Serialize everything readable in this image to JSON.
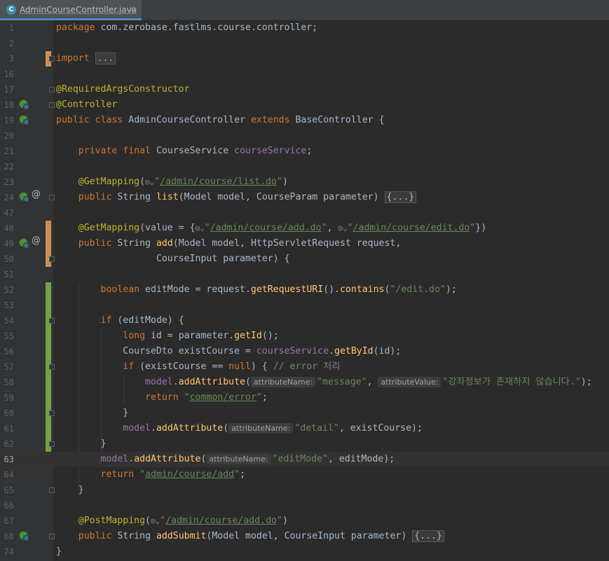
{
  "tab": {
    "icon": "C",
    "title": "AdminCourseController.java",
    "close": "×"
  },
  "colors": {
    "background": "#2b2b2b",
    "gutter": "#313335",
    "keyword": "#cc7832",
    "annotation": "#bbb529",
    "string": "#6a8759",
    "field": "#9876aa",
    "method": "#ffc66d",
    "modified_marker": "#c98f59",
    "added_marker": "#73a244"
  },
  "lines": [
    {
      "n": "1"
    },
    {
      "n": "2"
    },
    {
      "n": "3"
    },
    {
      "n": "16"
    },
    {
      "n": "17"
    },
    {
      "n": "18"
    },
    {
      "n": "19"
    },
    {
      "n": "20"
    },
    {
      "n": "21"
    },
    {
      "n": "22"
    },
    {
      "n": "23"
    },
    {
      "n": "24"
    },
    {
      "n": "47"
    },
    {
      "n": "48"
    },
    {
      "n": "49"
    },
    {
      "n": "50"
    },
    {
      "n": "51"
    },
    {
      "n": "52"
    },
    {
      "n": "53"
    },
    {
      "n": "54"
    },
    {
      "n": "55"
    },
    {
      "n": "56"
    },
    {
      "n": "57"
    },
    {
      "n": "58"
    },
    {
      "n": "59"
    },
    {
      "n": "60"
    },
    {
      "n": "61"
    },
    {
      "n": "62"
    },
    {
      "n": "63"
    },
    {
      "n": "64"
    },
    {
      "n": "65"
    },
    {
      "n": "66"
    },
    {
      "n": "67"
    },
    {
      "n": "68"
    },
    {
      "n": "74"
    }
  ],
  "code": {
    "l1": {
      "kw": "package",
      "rest": " com.zerobase.fastlms.course.controller;"
    },
    "l3": {
      "kw": "import",
      "fold": "..."
    },
    "l17": {
      "ann": "@RequiredArgsConstructor"
    },
    "l18": {
      "ann": "@Controller"
    },
    "l19": {
      "kw1": "public",
      "kw2": "class",
      "name": "AdminCourseController",
      "kw3": "extends",
      "base": "BaseController",
      "brace": " {"
    },
    "l21": {
      "kw1": "private",
      "kw2": "final",
      "type": "CourseService",
      "field": "courseService",
      "end": ";"
    },
    "l23": {
      "ann": "@GetMapping",
      "open": "(",
      "url": "/admin/course/list.do",
      "close": ")"
    },
    "l24": {
      "kw": "public",
      "type": "String",
      "method": "list",
      "sig1": "(Model ",
      "p1": "model",
      "sig2": ", CourseParam ",
      "p2": "parameter",
      "sig3": ") ",
      "fold": "{...}"
    },
    "l48": {
      "ann": "@GetMapping",
      "open": "(value = {",
      "url1": "/admin/course/add.do",
      "sep": ", ",
      "url2": "/admin/course/edit.do",
      "close": "})"
    },
    "l49": {
      "kw": "public",
      "type": "String",
      "method": "add",
      "sig1": "(Model ",
      "p1": "model",
      "sig2": ", HttpServletRequest ",
      "p2": "request",
      "sig3": ","
    },
    "l50": {
      "type": "CourseInput",
      "p": "parameter",
      "end": ") {"
    },
    "l52": {
      "kw": "boolean",
      "mid": " editMode = ",
      "p": "request",
      "dot": ".",
      "m1": "getRequestURI",
      "mid2": "().",
      "m2": "contains",
      "open": "(",
      "str": "\"/edit.do\"",
      "end": ");"
    },
    "l54": {
      "kw": "if",
      "rest": " (editMode) {"
    },
    "l55": {
      "kw": "long",
      "mid": " id = ",
      "p": "parameter",
      "dot": ".",
      "m": "getId",
      "end": "();"
    },
    "l56": {
      "type": "CourseDto existCourse = ",
      "f": "courseService",
      "dot": ".",
      "m": "getById",
      "end": "(id);"
    },
    "l57": {
      "kw": "if",
      "mid": " (existCourse == ",
      "kw2": "null",
      "mid2": ") { ",
      "cmt": "// error 처리"
    },
    "l58": {
      "f": "model",
      "dot": ".",
      "m": "addAttribute",
      "open": "(",
      "h1": "attributeName:",
      "s1": "\"message\"",
      "sep": ", ",
      "h2": "attributeValue:",
      "s2": "\"강좌정보가 존재하지 않습니다.\"",
      "end": ");"
    },
    "l59": {
      "kw": "return",
      "url": "common/error",
      "end": ";"
    },
    "l60": {
      "rest": "}"
    },
    "l61": {
      "f": "model",
      "dot": ".",
      "m": "addAttribute",
      "open": "(",
      "h": "attributeName:",
      "s": "\"detail\"",
      "end": ", existCourse);"
    },
    "l62": {
      "rest": "}"
    },
    "l63": {
      "f": "model",
      "dot": ".",
      "m": "addAttribute",
      "open": "(",
      "h": "attributeName:",
      "s": "\"editMode\"",
      "end": ", editMode);"
    },
    "l64": {
      "kw": "return",
      "url": "admin/course/add",
      "end": ";"
    },
    "l65": {
      "rest": "}"
    },
    "l67": {
      "ann": "@PostMapping",
      "open": "(",
      "url": "/admin/course/add.do",
      "close": ")"
    },
    "l68": {
      "kw": "public",
      "type": "String",
      "method": "addSubmit",
      "sig1": "(Model ",
      "p1": "model",
      "sig2": ", CourseInput ",
      "p2": "parameter",
      "sig3": ") ",
      "fold": "{...}"
    },
    "l74": {
      "rest": "}"
    }
  }
}
